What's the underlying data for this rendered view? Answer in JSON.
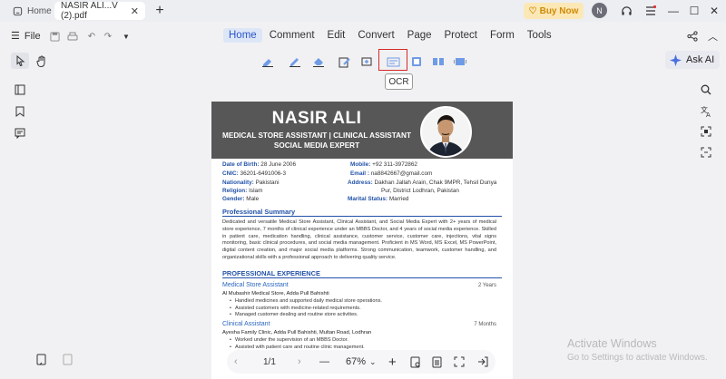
{
  "titlebar": {
    "home_tab": "Home",
    "doc_tab": "NASIR ALI...V (2).pdf",
    "buy_now": "Buy Now",
    "avatar_initial": "N"
  },
  "menubar": {
    "file": "File",
    "menus": [
      "Home",
      "Comment",
      "Edit",
      "Convert",
      "Page",
      "Protect",
      "Form",
      "Tools"
    ],
    "active_menu": "Home"
  },
  "toolbar": {
    "tooltip": "OCR",
    "ask_ai": "Ask AI"
  },
  "resume": {
    "name": "NASIR ALI",
    "role_line1": "MEDICAL STORE ASSISTANT | CLINICAL ASSISTANT",
    "role_line2": "SOCIAL MEDIA EXPERT",
    "dob_label": "Date of Birth:",
    "dob": "28 June 2006",
    "cnic_label": "CNIC:",
    "cnic": "36201-6491006-3",
    "nationality_label": "Nationality:",
    "nationality": "Pakistani",
    "religion_label": "Religion:",
    "religion": "Islam",
    "gender_label": "Gender:",
    "gender": "Male",
    "mobile_label": "Mobile:",
    "mobile": "+92 311-3972862",
    "email_label": "Email :",
    "email": "na8842667@gmail.com",
    "address_label": "Address:",
    "address1": "Dakhan Jallah Arain, Chak 9MPR, Tehsil Dunya",
    "address2": "Pur, District Lodhran, Pakistan",
    "marital_label": "Marital Status:",
    "marital": "Married",
    "summary_title": "Professional Summary",
    "summary": "Dedicated and versatile Medical Store Assistant, Clinical Assistant, and Social Media Expert with 2+ years of medical store experience, 7 months of clinical experience under an MBBS Doctor, and 4 years of social media experience. Skilled in patient care, medication handling, clinical assistance, customer service, customer care, injections, vital signs monitoring, basic clinical procedures, and social media management. Proficient in MS Word, MS Excel, MS PowerPoint, digital content creation, and major social media platforms. Strong communication, teamwork, customer handling, and organizational skills with a professional approach to delivering quality service.",
    "experience_title": "PROFESSIONAL EXPERIENCE",
    "jobs": [
      {
        "title": "Medical Store Assistant",
        "duration": "2 Years",
        "org": "Al Mubashir Medical Store, Adda Pull Bahishti",
        "bullets": [
          "Handled medicines and supported daily medical store operations.",
          "Assisted customers with medicine-related requirements.",
          "Managed customer dealing and routine store activities."
        ]
      },
      {
        "title": "Clinical Assistant",
        "duration": "7 Months",
        "org": "Ayesha Family Clinic, Adda Pull Bahishti, Multan Road, Lodhran",
        "bullets": [
          "Worked under the supervision of an MBBS Doctor.",
          "Assisted with patient care and routine clinic management."
        ]
      }
    ]
  },
  "bottombar": {
    "page_indicator": "1/1",
    "zoom": "67%"
  },
  "watermark": {
    "line1": "Activate Windows",
    "line2": "Go to Settings to activate Windows."
  },
  "colors": {
    "accent": "#2a56c6",
    "banner": "#575757",
    "buy_now_bg": "#fbe8b6",
    "buy_now_text": "#d08a06",
    "ocr_highlight": "#d62a2a",
    "resume_blue": "#2252a8"
  }
}
